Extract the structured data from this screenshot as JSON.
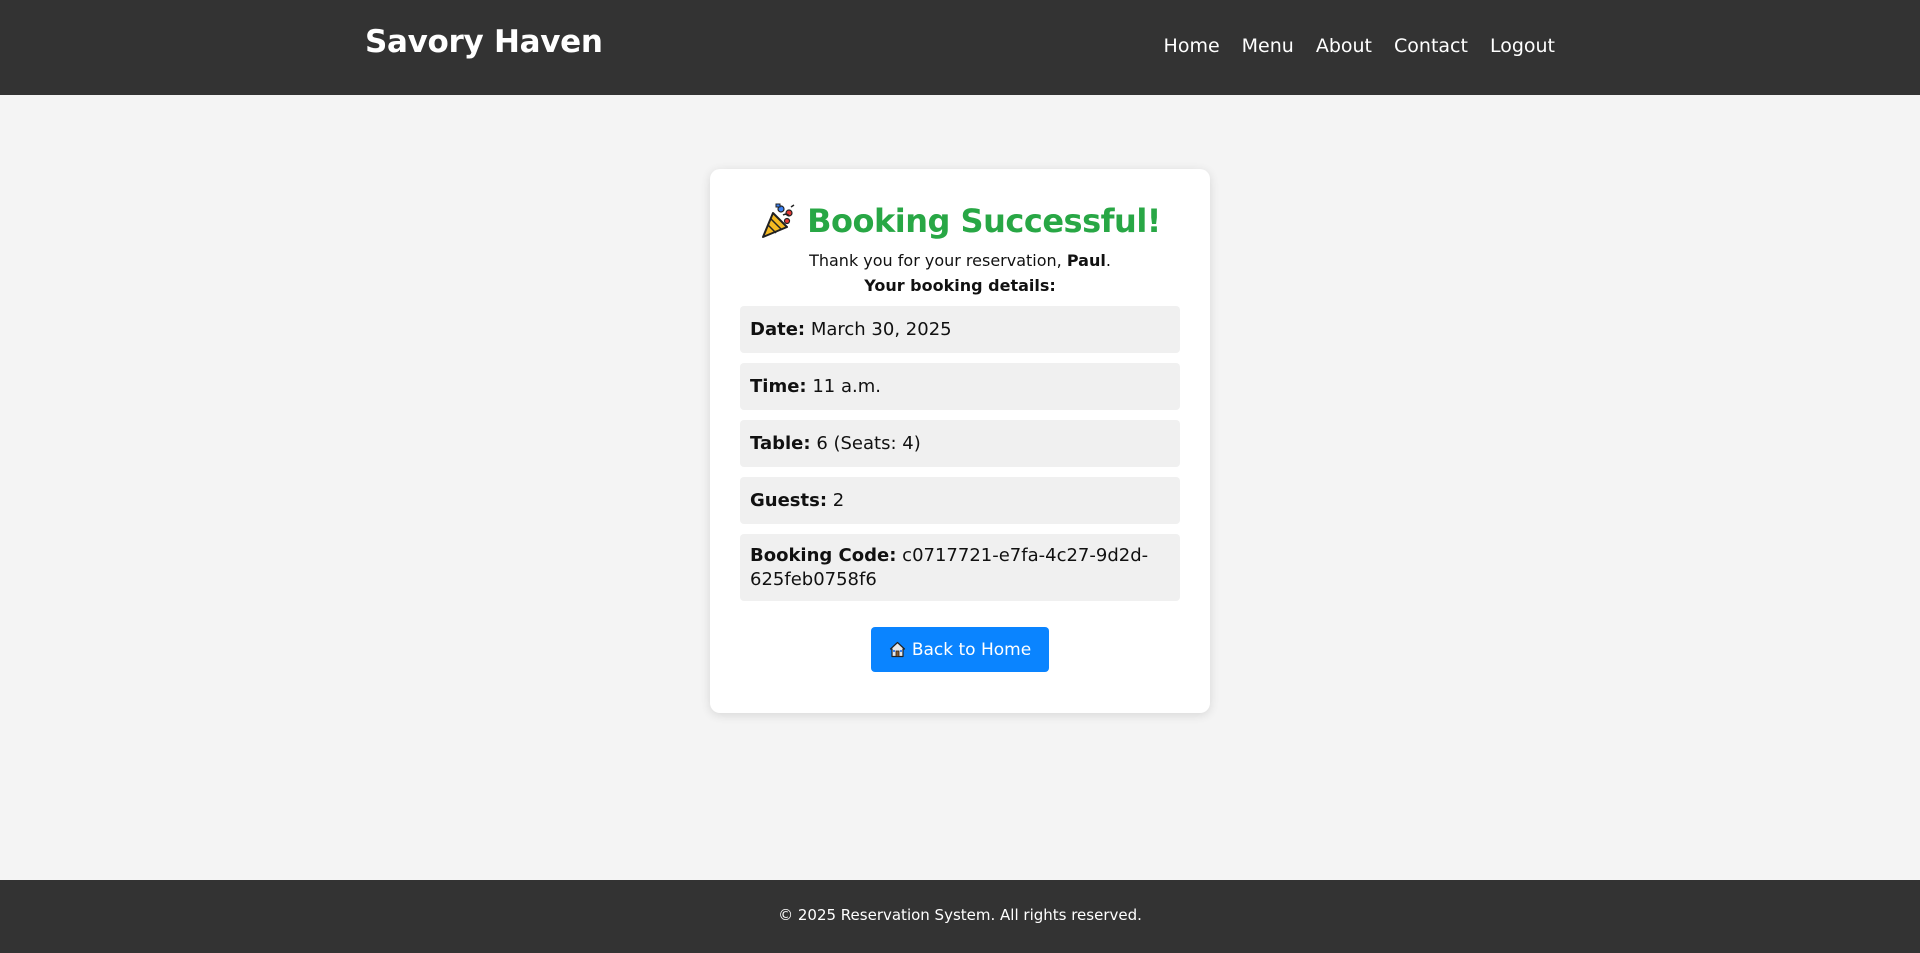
{
  "header": {
    "brand": "Savory Haven",
    "nav": [
      {
        "label": "Home"
      },
      {
        "label": "Menu"
      },
      {
        "label": "About"
      },
      {
        "label": "Contact"
      },
      {
        "label": "Logout"
      }
    ]
  },
  "confirmation": {
    "title": "Booking Successful!",
    "title_icon": "party-popper-icon",
    "thanks_prefix": "Thank you for your reservation, ",
    "guest_name": "Paul",
    "thanks_suffix": ".",
    "details_heading": "Your booking details:",
    "details": [
      {
        "label": "Date:",
        "value": "March 30, 2025"
      },
      {
        "label": "Time:",
        "value": "11 a.m."
      },
      {
        "label": "Table:",
        "value": "6 (Seats: 4)"
      },
      {
        "label": "Guests:",
        "value": "2"
      },
      {
        "label": "Booking Code:",
        "value": "c0717721-e7fa-4c27-9d2d-625feb0758f6"
      }
    ],
    "back_button": {
      "label": "Back to Home",
      "icon": "house-icon"
    }
  },
  "footer": {
    "text": "© 2025 Reservation System. All rights reserved."
  },
  "colors": {
    "header_bg": "#333333",
    "page_bg": "#f4f4f4",
    "success_green": "#28a745",
    "button_blue": "#0a84ff"
  }
}
